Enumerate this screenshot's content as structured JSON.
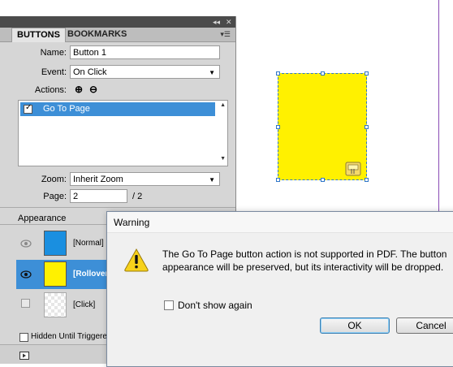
{
  "panel": {
    "tabs": [
      {
        "label": "BUTTONS"
      },
      {
        "label": "BOOKMARKS"
      }
    ],
    "name": {
      "label": "Name:",
      "value": "Button 1"
    },
    "event": {
      "label": "Event:",
      "value": "On Click"
    },
    "actions": {
      "label": "Actions:",
      "items": [
        {
          "label": "Go To Page",
          "checked": true
        }
      ]
    },
    "zoom": {
      "label": "Zoom:",
      "value": "Inherit Zoom"
    },
    "page": {
      "label": "Page:",
      "value": "2",
      "total": "/ 2"
    },
    "appearance": {
      "title": "Appearance",
      "states": [
        {
          "label": "[Normal]",
          "color": "#1a8fe0",
          "visible": true
        },
        {
          "label": "[Rollover]",
          "color": "#fff100",
          "visible": true,
          "selected": true
        },
        {
          "label": "[Click]",
          "color": "checker",
          "visible": false
        }
      ]
    },
    "hidden_until_triggered": {
      "label": "Hidden Until Triggered",
      "checked": false
    }
  },
  "dialog": {
    "title": "Warning",
    "message": "The Go To Page button action is not supported in PDF. The button appearance will be preserved, but its interactivity will be dropped.",
    "dont_show": {
      "label": "Don't show again",
      "checked": false
    },
    "ok_label": "OK",
    "cancel_label": "Cancel"
  },
  "colors": {
    "selection": "#3d8fd7",
    "button_fill": "#fff100",
    "page_edge": "#8a4bb5"
  }
}
